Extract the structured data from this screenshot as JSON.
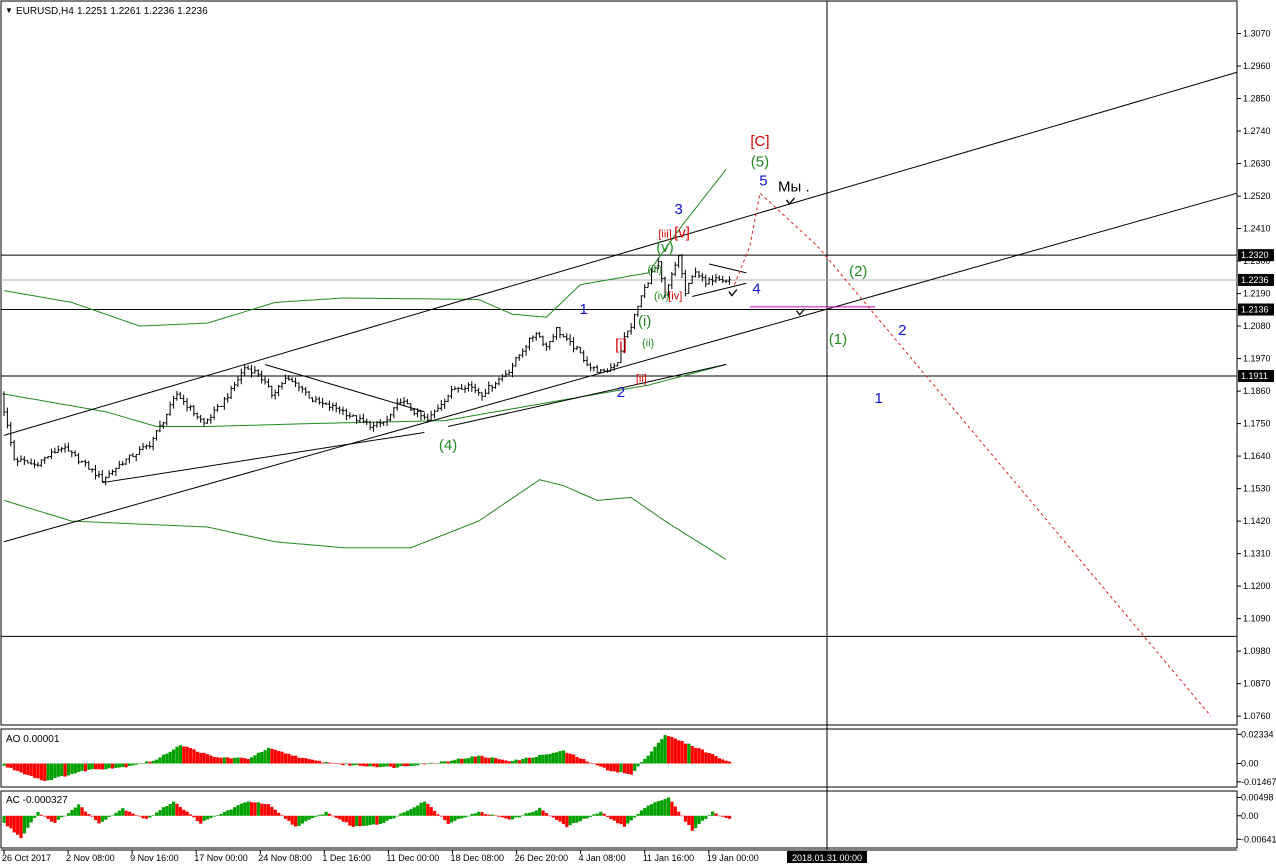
{
  "header": {
    "menu_glyph": "▼",
    "symbol": "EURUSD,H4",
    "ohlc": "1.2251 1.2261 1.2236 1.2236"
  },
  "colors": {
    "background": "#ffffff",
    "text": "#000000",
    "bull": "#00a000",
    "bear": "#ff0000",
    "envelope": "#1f8a1f",
    "wave_blue": "#1010d0",
    "wave_green": "#1f8a1f",
    "wave_red": "#dd0000",
    "projection": "#dd2222",
    "magenta": "#c000c0"
  },
  "chart_data": [
    {
      "type": "candlestick",
      "name": "price",
      "ylim": [
        1.073,
        1.318
      ],
      "y_ticks": [
        1.307,
        1.296,
        1.285,
        1.274,
        1.263,
        1.252,
        1.241,
        1.23,
        1.219,
        1.208,
        1.197,
        1.186,
        1.175,
        1.164,
        1.153,
        1.142,
        1.131,
        1.12,
        1.109,
        1.098,
        1.087,
        1.076
      ],
      "y_tick_labels": [
        "1.3070",
        "1.2960",
        "1.2850",
        "1.2740",
        "1.2630",
        "1.2520",
        "1.2410",
        "1.2300",
        "1.2190",
        "1.2080",
        "1.1970",
        "1.1860",
        "1.1750",
        "1.1640",
        "1.1530",
        "1.1420",
        "1.1310",
        "1.1200",
        "1.1090",
        "1.0980",
        "1.0870",
        "1.0760"
      ],
      "price_markers": [
        {
          "price": 1.232,
          "label": "1.2320"
        },
        {
          "price": 1.2236,
          "label": "1.2236"
        },
        {
          "price": 1.2136,
          "label": "1.2136"
        },
        {
          "price": 1.1911,
          "label": "1.1911"
        }
      ],
      "horizontal_levels": [
        1.232,
        1.2236,
        1.2136,
        1.1911,
        1.103
      ],
      "x_labels": [
        "26 Oct 2017",
        "2 Nov 08:00",
        "9 Nov 16:00",
        "17 Nov 00:00",
        "24 Nov 08:00",
        "1 Dec 16:00",
        "11 Dec 00:00",
        "18 Dec 08:00",
        "26 Dec 20:00",
        "4 Jan 08:00",
        "11 Jan 16:00",
        "19 Jan 00:00"
      ],
      "cursor_time_label": "2018.01.31 00:00",
      "price_path": [
        {
          "bar": 0,
          "price": 1.185
        },
        {
          "bar": 4,
          "price": 1.163
        },
        {
          "bar": 10,
          "price": 1.161
        },
        {
          "bar": 18,
          "price": 1.167
        },
        {
          "bar": 24,
          "price": 1.162
        },
        {
          "bar": 30,
          "price": 1.156
        },
        {
          "bar": 36,
          "price": 1.162
        },
        {
          "bar": 44,
          "price": 1.168
        },
        {
          "bar": 48,
          "price": 1.176
        },
        {
          "bar": 52,
          "price": 1.185
        },
        {
          "bar": 56,
          "price": 1.18
        },
        {
          "bar": 60,
          "price": 1.175
        },
        {
          "bar": 64,
          "price": 1.18
        },
        {
          "bar": 68,
          "price": 1.186
        },
        {
          "bar": 72,
          "price": 1.194
        },
        {
          "bar": 76,
          "price": 1.192
        },
        {
          "bar": 80,
          "price": 1.185
        },
        {
          "bar": 84,
          "price": 1.19
        },
        {
          "bar": 88,
          "price": 1.188
        },
        {
          "bar": 92,
          "price": 1.183
        },
        {
          "bar": 96,
          "price": 1.181
        },
        {
          "bar": 100,
          "price": 1.18
        },
        {
          "bar": 104,
          "price": 1.177
        },
        {
          "bar": 110,
          "price": 1.174
        },
        {
          "bar": 114,
          "price": 1.176
        },
        {
          "bar": 118,
          "price": 1.183
        },
        {
          "bar": 122,
          "price": 1.179
        },
        {
          "bar": 126,
          "price": 1.176
        },
        {
          "bar": 130,
          "price": 1.182
        },
        {
          "bar": 134,
          "price": 1.187
        },
        {
          "bar": 138,
          "price": 1.188
        },
        {
          "bar": 142,
          "price": 1.185
        },
        {
          "bar": 146,
          "price": 1.189
        },
        {
          "bar": 150,
          "price": 1.193
        },
        {
          "bar": 154,
          "price": 1.2
        },
        {
          "bar": 158,
          "price": 1.206
        },
        {
          "bar": 161,
          "price": 1.201
        },
        {
          "bar": 164,
          "price": 1.207
        },
        {
          "bar": 167,
          "price": 1.203
        },
        {
          "bar": 170,
          "price": 1.2
        },
        {
          "bar": 174,
          "price": 1.194
        },
        {
          "bar": 178,
          "price": 1.192
        },
        {
          "bar": 182,
          "price": 1.196
        },
        {
          "bar": 184,
          "price": 1.204
        },
        {
          "bar": 186,
          "price": 1.208
        },
        {
          "bar": 189,
          "price": 1.218
        },
        {
          "bar": 192,
          "price": 1.226
        },
        {
          "bar": 194,
          "price": 1.229
        },
        {
          "bar": 196,
          "price": 1.218
        },
        {
          "bar": 198,
          "price": 1.225
        },
        {
          "bar": 200,
          "price": 1.232
        },
        {
          "bar": 202,
          "price": 1.219
        },
        {
          "bar": 205,
          "price": 1.227
        },
        {
          "bar": 208,
          "price": 1.222
        },
        {
          "bar": 211,
          "price": 1.225
        },
        {
          "bar": 214,
          "price": 1.2236
        }
      ],
      "bar_count": 215,
      "visible_bars": 245,
      "projection_path": [
        {
          "bar": 215.5,
          "price": 1.222
        },
        {
          "bar": 220,
          "price": 1.235
        },
        {
          "bar": 223,
          "price": 1.253
        },
        {
          "bar": 240,
          "price": 1.235
        },
        {
          "bar": 356,
          "price": 1.076
        }
      ],
      "wave_labels": [
        {
          "text": "[C]",
          "bar": 223,
          "price": 1.269,
          "color": "#dd0000"
        },
        {
          "text": "(5)",
          "bar": 223,
          "price": 1.262,
          "color": "#1f8a1f"
        },
        {
          "text": "5",
          "bar": 224,
          "price": 1.2555,
          "color": "#1010d0"
        },
        {
          "text": "Мы .",
          "bar": 233,
          "price": 1.2535,
          "color": "#000000"
        },
        {
          "text": "3",
          "bar": 199,
          "price": 1.246,
          "color": "#1010d0"
        },
        {
          "text": "[iii]",
          "bar": 195,
          "price": 1.238,
          "color": "#dd0000"
        },
        {
          "text": "[v]",
          "bar": 200,
          "price": 1.238,
          "color": "#dd0000"
        },
        {
          "text": "(v)",
          "bar": 195,
          "price": 1.233,
          "color": "#1f8a1f"
        },
        {
          "text": "(iii)",
          "bar": 192,
          "price": 1.226,
          "color": "#1f8a1f"
        },
        {
          "text": "(iv)",
          "bar": 194,
          "price": 1.217,
          "color": "#1f8a1f"
        },
        {
          "text": "[iv]",
          "bar": 198,
          "price": 1.217,
          "color": "#dd0000"
        },
        {
          "text": "4",
          "bar": 222,
          "price": 1.219,
          "color": "#1010d0"
        },
        {
          "text": "1",
          "bar": 171,
          "price": 1.212,
          "color": "#1010d0"
        },
        {
          "text": "(i)",
          "bar": 189,
          "price": 1.208,
          "color": "#1f8a1f"
        },
        {
          "text": "[i]",
          "bar": 182,
          "price": 1.2,
          "color": "#dd0000"
        },
        {
          "text": "(ii)",
          "bar": 190,
          "price": 1.201,
          "color": "#1f8a1f"
        },
        {
          "text": "[ii]",
          "bar": 188,
          "price": 1.189,
          "color": "#dd0000"
        },
        {
          "text": "2",
          "bar": 182,
          "price": 1.184,
          "color": "#1010d0"
        },
        {
          "text": "(4)",
          "bar": 131,
          "price": 1.166,
          "color": "#1f8a1f"
        },
        {
          "text": "(2)",
          "bar": 252,
          "price": 1.225,
          "color": "#1f8a1f"
        },
        {
          "text": "(1)",
          "bar": 246,
          "price": 1.202,
          "color": "#1f8a1f"
        },
        {
          "text": "2",
          "bar": 265,
          "price": 1.205,
          "color": "#1010d0"
        },
        {
          "text": "1",
          "bar": 258,
          "price": 1.182,
          "color": "#1010d0"
        }
      ],
      "check_marks": [
        {
          "bar": 232,
          "price": 1.25
        },
        {
          "bar": 215,
          "price": 1.219
        },
        {
          "bar": 235,
          "price": 1.2125
        }
      ],
      "trend_lines": [
        {
          "from": {
            "bar": 0,
            "price": 1.171
          },
          "to": {
            "bar": 370,
            "price": 1.296
          }
        },
        {
          "from": {
            "bar": 0,
            "price": 1.135
          },
          "to": {
            "bar": 370,
            "price": 1.255
          }
        },
        {
          "from": {
            "bar": 29,
            "price": 1.155
          },
          "to": {
            "bar": 124,
            "price": 1.172
          }
        },
        {
          "from": {
            "bar": 77,
            "price": 1.195
          },
          "to": {
            "bar": 124,
            "price": 1.179
          }
        },
        {
          "from": {
            "bar": 131,
            "price": 1.174
          },
          "to": {
            "bar": 213,
            "price": 1.195
          }
        },
        {
          "from": {
            "bar": 208,
            "price": 1.229
          },
          "to": {
            "bar": 219,
            "price": 1.226
          }
        },
        {
          "from": {
            "bar": 203,
            "price": 1.218
          },
          "to": {
            "bar": 219,
            "price": 1.2225
          }
        },
        {
          "from": {
            "bar": 220,
            "price": 1.2145
          },
          "to": {
            "bar": 257,
            "price": 1.2145
          },
          "color": "#c000c0"
        }
      ],
      "envelope_upper": [
        {
          "bar": 0,
          "price": 1.22
        },
        {
          "bar": 20,
          "price": 1.216
        },
        {
          "bar": 40,
          "price": 1.208
        },
        {
          "bar": 60,
          "price": 1.209
        },
        {
          "bar": 80,
          "price": 1.216
        },
        {
          "bar": 100,
          "price": 1.2175
        },
        {
          "bar": 140,
          "price": 1.217
        },
        {
          "bar": 150,
          "price": 1.212
        },
        {
          "bar": 160,
          "price": 1.211
        },
        {
          "bar": 170,
          "price": 1.222
        },
        {
          "bar": 180,
          "price": 1.224
        },
        {
          "bar": 190,
          "price": 1.226
        },
        {
          "bar": 200,
          "price": 1.242
        },
        {
          "bar": 213,
          "price": 1.261
        }
      ],
      "envelope_mid": [
        {
          "bar": 0,
          "price": 1.185
        },
        {
          "bar": 30,
          "price": 1.179
        },
        {
          "bar": 45,
          "price": 1.174
        },
        {
          "bar": 60,
          "price": 1.174
        },
        {
          "bar": 90,
          "price": 1.175
        },
        {
          "bar": 130,
          "price": 1.176
        },
        {
          "bar": 160,
          "price": 1.182
        },
        {
          "bar": 190,
          "price": 1.188
        },
        {
          "bar": 213,
          "price": 1.195
        }
      ],
      "envelope_lower": [
        {
          "bar": 0,
          "price": 1.149
        },
        {
          "bar": 20,
          "price": 1.142
        },
        {
          "bar": 40,
          "price": 1.141
        },
        {
          "bar": 60,
          "price": 1.14
        },
        {
          "bar": 80,
          "price": 1.135
        },
        {
          "bar": 100,
          "price": 1.133
        },
        {
          "bar": 120,
          "price": 1.133
        },
        {
          "bar": 140,
          "price": 1.142
        },
        {
          "bar": 158,
          "price": 1.156
        },
        {
          "bar": 165,
          "price": 1.154
        },
        {
          "bar": 175,
          "price": 1.149
        },
        {
          "bar": 185,
          "price": 1.15
        },
        {
          "bar": 195,
          "price": 1.142
        },
        {
          "bar": 213,
          "price": 1.129
        }
      ]
    },
    {
      "type": "bar",
      "name": "AO",
      "title": "AO 0.00001",
      "ylim": [
        -0.018,
        0.026
      ],
      "y_ticks": [
        0.02334,
        0.0,
        -0.01467
      ],
      "y_tick_labels": [
        "0.02334",
        "0.00",
        "-0.01467"
      ],
      "keyframes": [
        {
          "bar": 0,
          "value": -0.002
        },
        {
          "bar": 12,
          "value": -0.014
        },
        {
          "bar": 25,
          "value": -0.005
        },
        {
          "bar": 35,
          "value": -0.003
        },
        {
          "bar": 45,
          "value": 0.003
        },
        {
          "bar": 52,
          "value": 0.015
        },
        {
          "bar": 62,
          "value": 0.005
        },
        {
          "bar": 72,
          "value": 0.004
        },
        {
          "bar": 78,
          "value": 0.012
        },
        {
          "bar": 90,
          "value": 0.003
        },
        {
          "bar": 100,
          "value": -0.001
        },
        {
          "bar": 115,
          "value": -0.003
        },
        {
          "bar": 128,
          "value": 0.001
        },
        {
          "bar": 140,
          "value": 0.006
        },
        {
          "bar": 150,
          "value": 0.002
        },
        {
          "bar": 165,
          "value": 0.01
        },
        {
          "bar": 178,
          "value": -0.005
        },
        {
          "bar": 185,
          "value": -0.009
        },
        {
          "bar": 195,
          "value": 0.023
        },
        {
          "bar": 205,
          "value": 0.012
        },
        {
          "bar": 214,
          "value": 0.001
        }
      ]
    },
    {
      "type": "bar",
      "name": "AC",
      "title": "AC -0.000327",
      "ylim": [
        -0.0085,
        0.0062
      ],
      "y_ticks": [
        0.00498,
        0.0,
        -0.00641
      ],
      "y_tick_labels": [
        "0.00498",
        "0.00",
        "-0.00641"
      ],
      "keyframes": [
        {
          "bar": 0,
          "value": -0.002
        },
        {
          "bar": 5,
          "value": -0.006
        },
        {
          "bar": 10,
          "value": 0.001
        },
        {
          "bar": 15,
          "value": -0.002
        },
        {
          "bar": 22,
          "value": 0.003
        },
        {
          "bar": 28,
          "value": -0.002
        },
        {
          "bar": 35,
          "value": 0.002
        },
        {
          "bar": 42,
          "value": -0.001
        },
        {
          "bar": 50,
          "value": 0.004
        },
        {
          "bar": 58,
          "value": -0.002
        },
        {
          "bar": 65,
          "value": 0.001
        },
        {
          "bar": 72,
          "value": 0.004
        },
        {
          "bar": 78,
          "value": 0.003
        },
        {
          "bar": 86,
          "value": -0.003
        },
        {
          "bar": 95,
          "value": 0.001
        },
        {
          "bar": 103,
          "value": -0.003
        },
        {
          "bar": 112,
          "value": -0.002
        },
        {
          "bar": 124,
          "value": 0.004
        },
        {
          "bar": 131,
          "value": -0.002
        },
        {
          "bar": 140,
          "value": 0.001
        },
        {
          "bar": 150,
          "value": -0.001
        },
        {
          "bar": 158,
          "value": 0.002
        },
        {
          "bar": 166,
          "value": -0.003
        },
        {
          "bar": 176,
          "value": 0.001
        },
        {
          "bar": 183,
          "value": -0.003
        },
        {
          "bar": 190,
          "value": 0.003
        },
        {
          "bar": 196,
          "value": 0.005
        },
        {
          "bar": 203,
          "value": -0.004
        },
        {
          "bar": 209,
          "value": 0.001
        },
        {
          "bar": 214,
          "value": -0.001
        }
      ]
    }
  ]
}
